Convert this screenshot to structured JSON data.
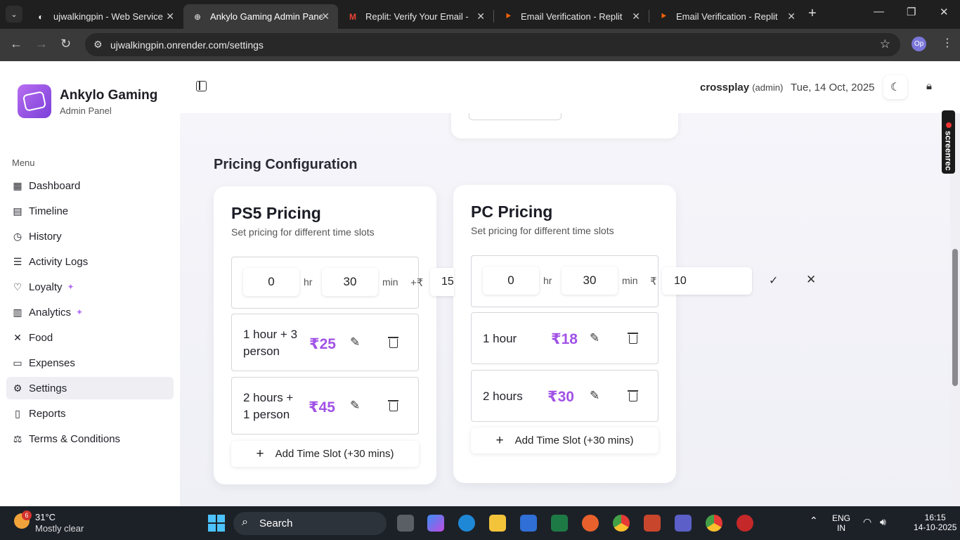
{
  "browser": {
    "tabs": [
      {
        "title": "ujwalkingpin - Web Service",
        "icon": "render-icon",
        "active": false
      },
      {
        "title": "Ankylo Gaming Admin Panel",
        "icon": "globe-icon",
        "active": true
      },
      {
        "title": "Replit: Verify Your Email - op",
        "icon": "gmail-icon",
        "active": false
      },
      {
        "title": "Email Verification - Replit",
        "icon": "replit-icon",
        "active": false
      },
      {
        "title": "Email Verification - Replit",
        "icon": "replit-icon",
        "active": false
      }
    ],
    "url": "ujwalkingpin.onrender.com/settings",
    "profile_initials": "Op"
  },
  "sidebar": {
    "brand_title": "Ankylo Gaming",
    "brand_subtitle": "Admin Panel",
    "menu_label": "Menu",
    "items": [
      {
        "label": "Dashboard",
        "icon": "grid-icon",
        "sparkle": false,
        "active": false
      },
      {
        "label": "Timeline",
        "icon": "calendar-icon",
        "sparkle": false,
        "active": false
      },
      {
        "label": "History",
        "icon": "clock-icon",
        "sparkle": false,
        "active": false
      },
      {
        "label": "Activity Logs",
        "icon": "list-icon",
        "sparkle": false,
        "active": false
      },
      {
        "label": "Loyalty",
        "icon": "heart-icon",
        "sparkle": true,
        "active": false
      },
      {
        "label": "Analytics",
        "icon": "chart-icon",
        "sparkle": true,
        "active": false
      },
      {
        "label": "Food",
        "icon": "utensils-icon",
        "sparkle": false,
        "active": false
      },
      {
        "label": "Expenses",
        "icon": "receipt-icon",
        "sparkle": false,
        "active": false
      },
      {
        "label": "Settings",
        "icon": "gear-icon",
        "sparkle": false,
        "active": true
      },
      {
        "label": "Reports",
        "icon": "file-icon",
        "sparkle": false,
        "active": false
      },
      {
        "label": "Terms & Conditions",
        "icon": "scale-icon",
        "sparkle": false,
        "active": false
      }
    ]
  },
  "header": {
    "username": "crossplay",
    "role": "(admin)",
    "date": "Tue, 14 Oct, 2025"
  },
  "main": {
    "section_title": "Pricing Configuration",
    "ps5": {
      "title": "PS5 Pricing",
      "subtitle": "Set pricing for different time slots",
      "edit": {
        "hours": "0",
        "hr_unit": "hr",
        "minutes": "30",
        "min_unit": "min",
        "plus_currency": "+₹",
        "price": "15"
      },
      "slots": [
        {
          "label_line1": "1 hour + 3",
          "label_line2": "person",
          "price": "₹25"
        },
        {
          "label_line1": "2 hours +",
          "label_line2": "1 person",
          "price": "₹45"
        }
      ],
      "add_label": "Add Time Slot (+30 mins)"
    },
    "pc": {
      "title": "PC Pricing",
      "subtitle": "Set pricing for different time slots",
      "edit": {
        "hours": "0",
        "hr_unit": "hr",
        "minutes": "30",
        "min_unit": "min",
        "currency": "₹",
        "price": "10"
      },
      "slots": [
        {
          "label": "1 hour",
          "price": "₹18"
        },
        {
          "label": "2 hours",
          "price": "₹30"
        }
      ],
      "add_label": "Add Time Slot (+30 mins)"
    }
  },
  "overlay": {
    "screenrec_label": "screenrec"
  },
  "taskbar": {
    "weather_temp": "31°C",
    "weather_desc": "Mostly clear",
    "weather_badge": "6",
    "search_label": "Search",
    "lang_line1": "ENG",
    "lang_line2": "IN",
    "time": "16:15",
    "date": "14-10-2025"
  },
  "colors": {
    "accent": "#a152e6",
    "active_tab": "#3a3a3a"
  }
}
